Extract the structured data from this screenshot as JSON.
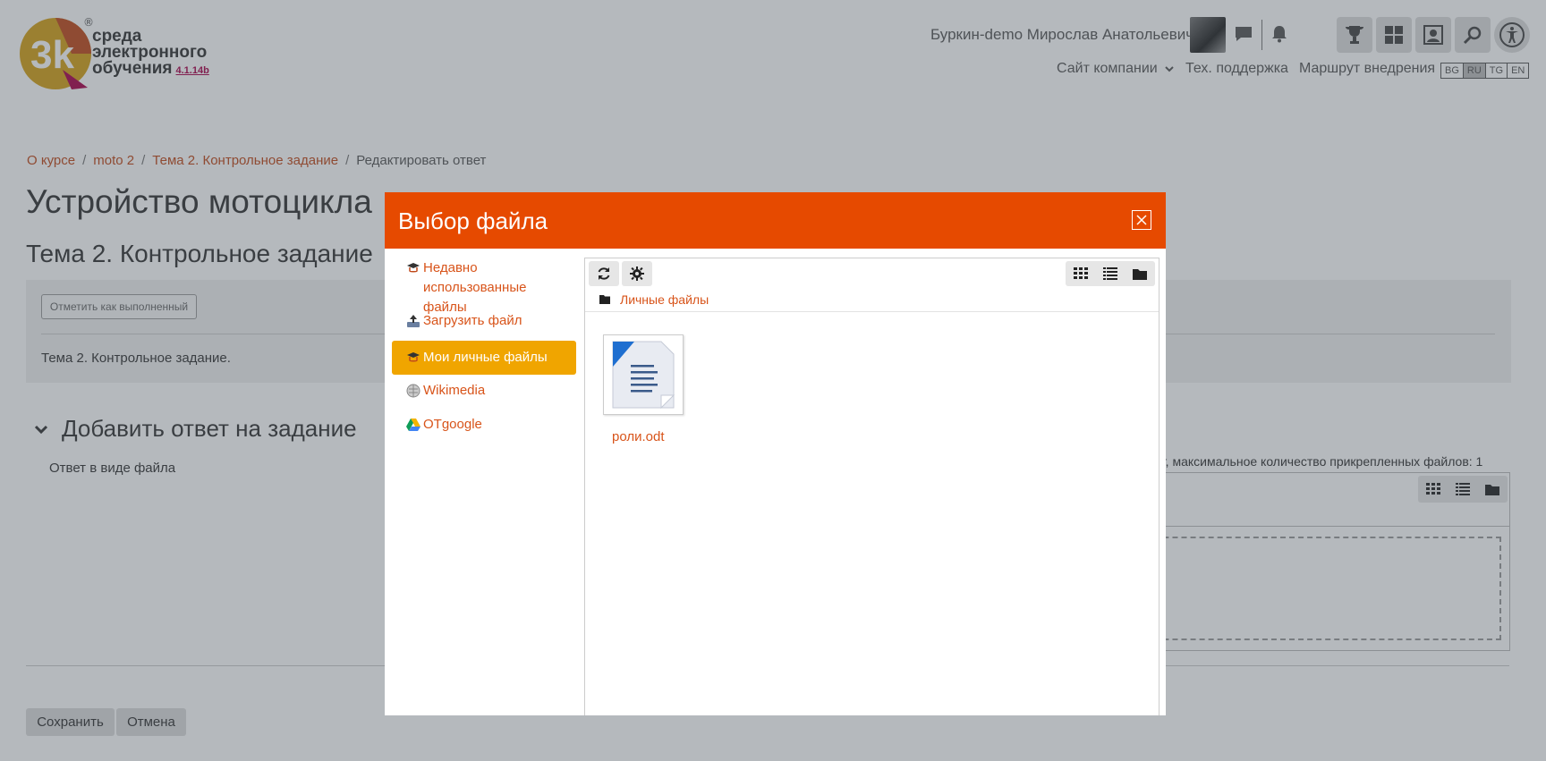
{
  "app": {
    "logo_text_line1": "среда",
    "logo_text_line2": "электронного",
    "logo_text_line3": "обучения",
    "version": "4.1.14b",
    "registered_mark": "®"
  },
  "header": {
    "user_name": "Буркин-demo Мирослав Анатольевич",
    "nav": {
      "company_site": "Сайт компании",
      "support": "Тех. поддержка",
      "roadmap": "Маршрут внедрения"
    },
    "languages": [
      "BG",
      "RU",
      "TG",
      "EN"
    ],
    "active_language": "RU"
  },
  "breadcrumb": {
    "items": [
      "О курсе",
      "moto 2",
      "Тема 2. Контрольное задание",
      "Редактировать ответ"
    ]
  },
  "page": {
    "title": "Устройство мотоцикла",
    "subtitle": "Тема 2. Контрольное задание",
    "mark_done_button": "Отметить как выполненный",
    "description": "Тема 2. Контрольное задание.",
    "section_title": "Добавить ответ на задание",
    "answer_label": "Ответ в виде файла",
    "limit_text": "ит, максимальное количество прикрепленных файлов: 1",
    "save_button": "Сохранить",
    "cancel_button": "Отмена"
  },
  "modal": {
    "title": "Выбор файла",
    "repositories": [
      {
        "label_line1": "Недавно",
        "label_line2": "использованные файлы",
        "icon": "recent-files-icon"
      },
      {
        "label": "Загрузить файл",
        "icon": "upload-icon"
      },
      {
        "label": "Мои личные файлы",
        "icon": "private-files-icon",
        "active": true
      },
      {
        "label": "Wikimedia",
        "icon": "wikimedia-icon"
      },
      {
        "label": "OTgoogle",
        "icon": "google-drive-icon"
      }
    ],
    "path": "Личные файлы",
    "files": [
      {
        "name": "роли.odt",
        "icon": "document-icon"
      }
    ]
  },
  "colors": {
    "accent_orange": "#e64a00",
    "link_orange": "#d8541a",
    "active_item": "#f0a500",
    "version_color": "#a8004a"
  }
}
